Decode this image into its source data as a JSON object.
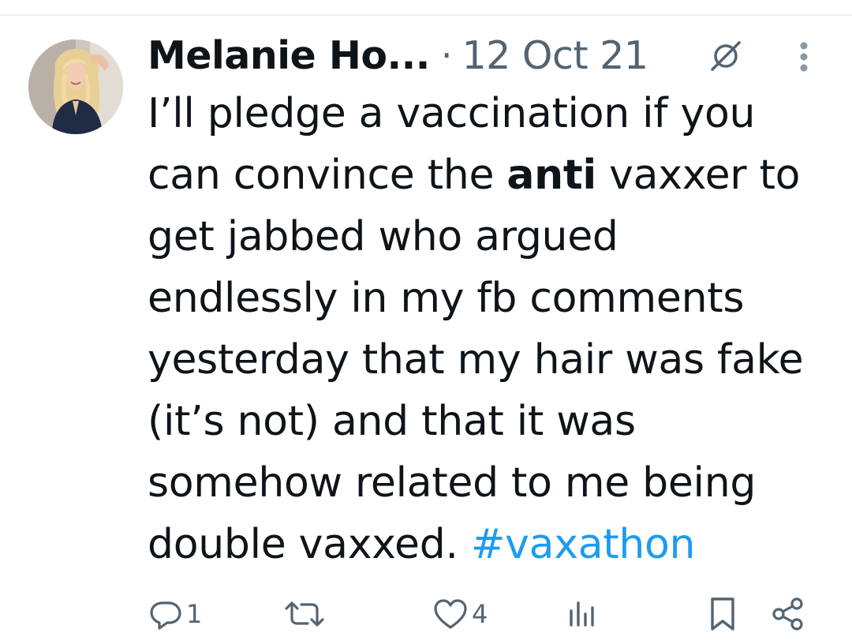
{
  "tweet": {
    "author_name": "Melanie Ho...",
    "separator": "·",
    "date": "12 Oct 21",
    "text_lines": [
      {
        "before": "I’ll pledge a vaccination if you",
        "bold": "",
        "after": ""
      },
      {
        "before": "can convince the ",
        "bold": "anti",
        "after": " vaxxer to"
      },
      {
        "before": "get jabbed who argued",
        "bold": "",
        "after": ""
      },
      {
        "before": "endlessly in my fb comments",
        "bold": "",
        "after": ""
      },
      {
        "before": "yesterday that my hair was fake",
        "bold": "",
        "after": ""
      },
      {
        "before": "(it’s not) and that it was",
        "bold": "",
        "after": ""
      },
      {
        "before": "somehow related to me being",
        "bold": "",
        "after": ""
      },
      {
        "before": "double vaxxed. ",
        "bold": "",
        "after": "",
        "hashtag": "#vaxathon"
      }
    ]
  },
  "actions": {
    "reply": {
      "icon": "reply-icon",
      "count": "1"
    },
    "retweet": {
      "icon": "retweet-icon",
      "count": ""
    },
    "like": {
      "icon": "heart-icon",
      "count": "4"
    },
    "views": {
      "icon": "views-icon",
      "count": ""
    },
    "bookmark": {
      "icon": "bookmark-icon"
    },
    "share": {
      "icon": "share-icon"
    }
  },
  "colors": {
    "text": "#0f1419",
    "secondary": "#536471",
    "link": "#1d9bf0",
    "divider": "#eff3f4"
  }
}
